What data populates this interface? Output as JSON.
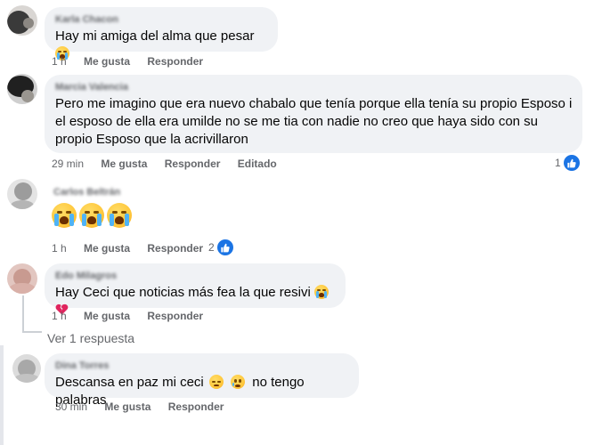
{
  "comments": [
    {
      "name": "Karla Chacon",
      "text_lines": [
        "Hay mi amiga del alma que pesar"
      ],
      "emoji": [
        "loudly-crying-face-icon"
      ],
      "time": "1 h",
      "like_label": "Me gusta",
      "reply_label": "Responder"
    },
    {
      "name": "Marcia Valencia",
      "text_lines": [
        "Pero me imagino que era nuevo chabalo que tenía porque ella tenía su propio Esposo i",
        "el esposo de ella era umilde no se me tia con nadie no creo que haya sido con su",
        "propio Esposo que la acrivillaron"
      ],
      "time": "29 min",
      "like_label": "Me gusta",
      "reply_label": "Responder",
      "edited_label": "Editado",
      "reactions": "1"
    },
    {
      "name": "Carlos Beltrán",
      "text_lines": [],
      "emoji": [
        "loudly-crying-face-icon",
        "loudly-crying-face-icon",
        "loudly-crying-face-icon"
      ],
      "time": "1 h",
      "like_label": "Me gusta",
      "reply_label": "Responder",
      "reactions": "2"
    },
    {
      "name": "Edo Milagros",
      "text_lines": [
        "Hay Ceci que noticias más fea la que resivi"
      ],
      "emoji": [
        "loudly-crying-face-icon",
        "broken-heart-icon"
      ],
      "time": "1 h",
      "like_label": "Me gusta",
      "reply_label": "Responder"
    },
    {
      "name": "Dina Torres",
      "text_lines": [
        "Descansa en paz mi ceci",
        "no tengo palabras"
      ],
      "emoji": [
        "pensive-face-icon",
        "sad-face-icon"
      ],
      "time": "30 min",
      "like_label": "Me gusta",
      "reply_label": "Responder"
    }
  ],
  "view_replies": "Ver 1 respuesta",
  "colors": {
    "bubble": "#f0f2f5",
    "meta_text": "#65676b",
    "like_blue": "#1b74e4"
  }
}
